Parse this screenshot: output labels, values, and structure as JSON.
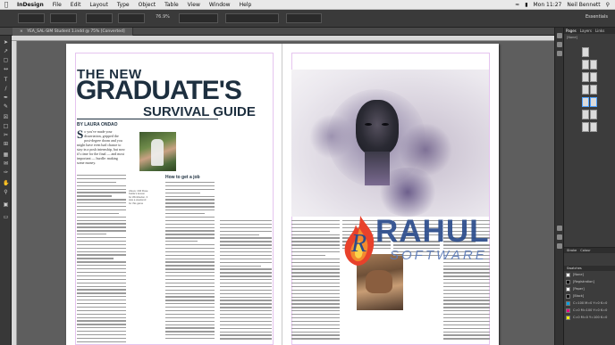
{
  "menubar": {
    "app_name": "InDesign",
    "menus": [
      "File",
      "Edit",
      "Layout",
      "Type",
      "Object",
      "Table",
      "View",
      "Window",
      "Help"
    ],
    "clock": "Mon 11:27",
    "user": "Neil Bennett"
  },
  "control": {
    "zoom": "76.9%",
    "workspace": "Essentials"
  },
  "document": {
    "tab_label": "YEA_SAL-SIM Student 1.indd @ 75% [Converted]"
  },
  "spread": {
    "kicker": "THE NEW",
    "headline": "GRADUATE'S",
    "subhead": "SURVIVAL GUIDE",
    "byline": "BY LAURA ONDAO",
    "dropcap": "S",
    "lead_text": "o you've made your dissertation, gripped the post-degree doom and you might have even had chance to stay in a posh internship, but now it's time for the final — and most important — hurdle: making some money.",
    "section_heading": "How to get a job",
    "caption_left": "Above: 240 Rose Kettle’s lesson for Wimbledon. It was a weekend for this game",
    "caption_right": "Steve is heading an office"
  },
  "watermark": {
    "brand": "RAHUL",
    "sub": "SOFTWARE"
  },
  "panel": {
    "tabs": [
      "Pages",
      "Layers",
      "Links"
    ],
    "section_none": "[None]",
    "stroke_tab": "Stroke",
    "color_tab": "Colour",
    "swatches_tab": "Swatches",
    "swatch_names": [
      "[None]",
      "[Registration]",
      "[Paper]",
      "[Black]",
      "C=100 M=0 Y=0 K=0",
      "C=0 M=100 Y=0 K=0",
      "C=0 M=0 Y=100 K=0"
    ]
  },
  "colors": {
    "headline": "#1d2f3f",
    "pasteboard": "#5e5e5e",
    "watermark_blue": "#2b4c8c"
  }
}
